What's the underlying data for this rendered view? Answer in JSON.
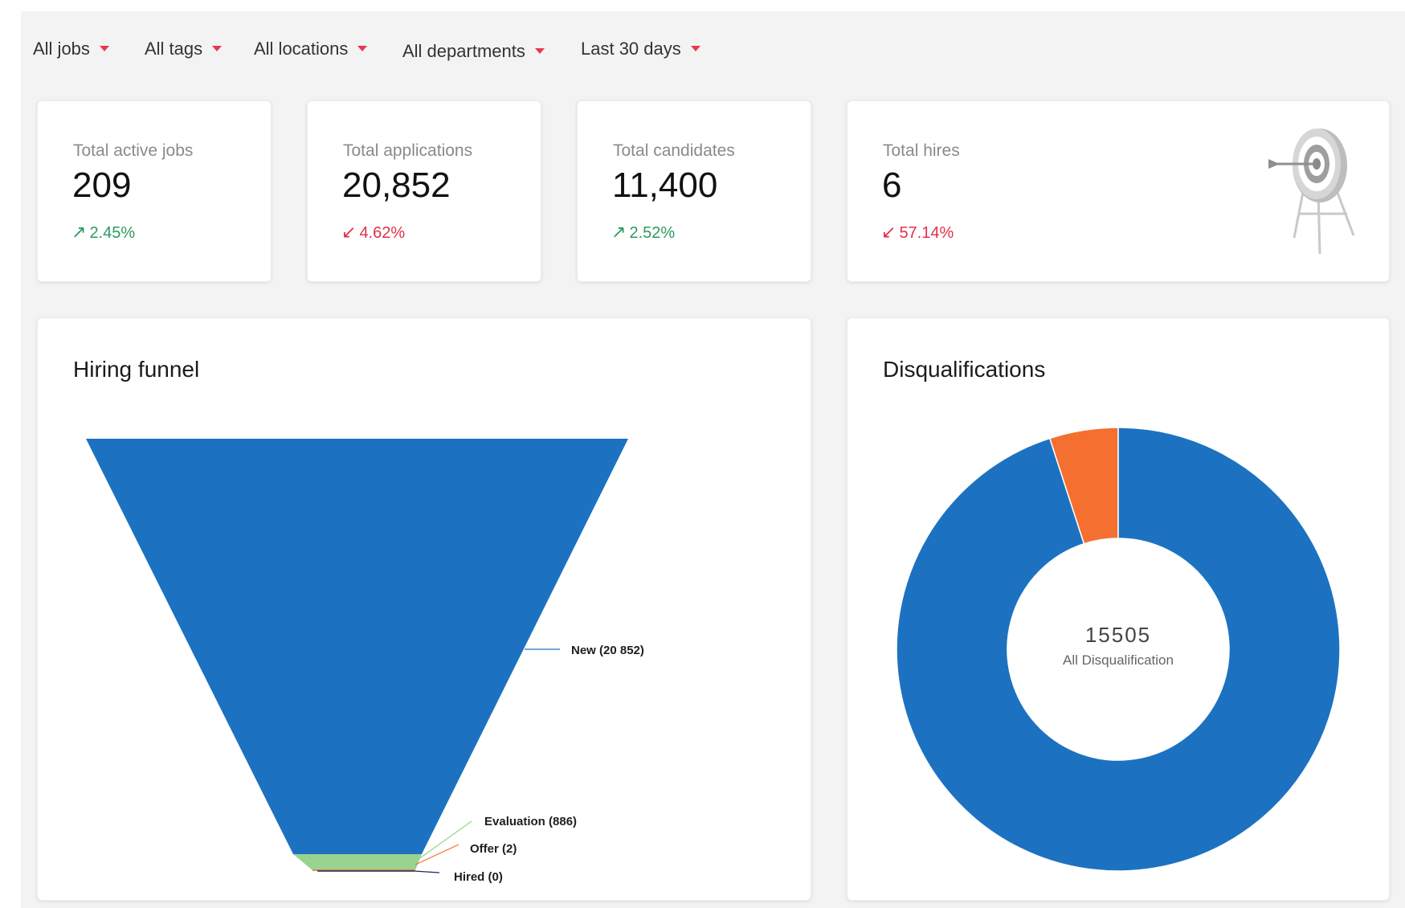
{
  "filters": {
    "jobs": "All jobs",
    "tags": "All tags",
    "locations": "All locations",
    "departments": "All departments",
    "period": "Last 30 days"
  },
  "stats": {
    "active_jobs": {
      "label": "Total active jobs",
      "value": "209",
      "change": "2.45%",
      "direction": "up"
    },
    "applications": {
      "label": "Total applications",
      "value": "20,852",
      "change": "4.62%",
      "direction": "down"
    },
    "candidates": {
      "label": "Total candidates",
      "value": "11,400",
      "change": "2.52%",
      "direction": "up"
    },
    "hires": {
      "label": "Total hires",
      "value": "6",
      "change": "57.14%",
      "direction": "down",
      "icon": "target-icon"
    }
  },
  "colors": {
    "up": "#2d9a5f",
    "down": "#e0314a",
    "caret": "#e8384f",
    "funnel_blue": "#1c72c0",
    "funnel_green": "#98d38f",
    "donut_blue": "#1c72c0",
    "donut_orange": "#f46f30"
  },
  "hiring_funnel": {
    "title": "Hiring funnel",
    "chart_data": {
      "type": "funnel",
      "stages": [
        {
          "name": "New",
          "value": 20852,
          "label": "New (20 852)",
          "color": "#1c72c0"
        },
        {
          "name": "Evaluation",
          "value": 886,
          "label": "Evaluation (886)",
          "color": "#98d38f"
        },
        {
          "name": "Offer",
          "value": 2,
          "label": "Offer (2)",
          "color": "#f46f30"
        },
        {
          "name": "Hired",
          "value": 0,
          "label": "Hired (0)",
          "color": "#1a2a5a"
        }
      ]
    }
  },
  "disqualifications": {
    "title": "Disqualifications",
    "center_value": "15505",
    "center_label": "All Disqualification",
    "chart_data": {
      "type": "pie",
      "total": 15505,
      "slices": [
        {
          "share": 0.95,
          "color": "#1c72c0"
        },
        {
          "share": 0.05,
          "color": "#f46f30"
        }
      ]
    }
  }
}
